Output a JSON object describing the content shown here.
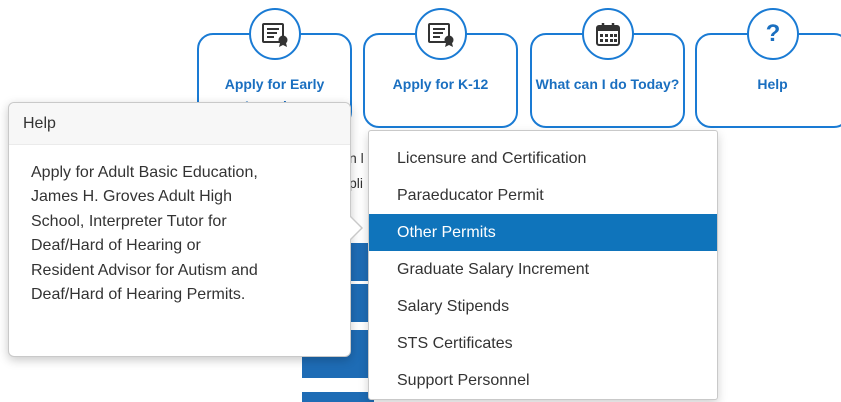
{
  "cards": [
    {
      "label": "Apply for Early Learning",
      "icon": "certificate-icon"
    },
    {
      "label": "Apply for K-12",
      "icon": "certificate-icon"
    },
    {
      "label": "What can I do Today?",
      "icon": "calendar-icon"
    },
    {
      "label": "Help",
      "icon": "question-mark-icon"
    }
  ],
  "help_popover": {
    "title": "Help",
    "body": [
      "Apply for Adult Basic Education,",
      "James H. Groves Adult High",
      "School, Interpreter Tutor for",
      "Deaf/Hard of Hearing or",
      "Resident Advisor for Autism and",
      "Deaf/Hard of Hearing Permits."
    ]
  },
  "background_text": [
    "n l",
    "pli"
  ],
  "dropdown": {
    "items": [
      {
        "label": "Licensure and Certification",
        "active": false
      },
      {
        "label": "Paraeducator Permit",
        "active": false
      },
      {
        "label": "Other Permits",
        "active": true
      },
      {
        "label": "Graduate Salary Increment",
        "active": false
      },
      {
        "label": "Salary Stipends",
        "active": false
      },
      {
        "label": "STS Certificates",
        "active": false
      },
      {
        "label": "Support Personnel",
        "active": false
      }
    ]
  },
  "colors": {
    "accent": "#1a7bd4",
    "active_item": "#0f74bb",
    "button_fill": "#1e6cb5"
  }
}
